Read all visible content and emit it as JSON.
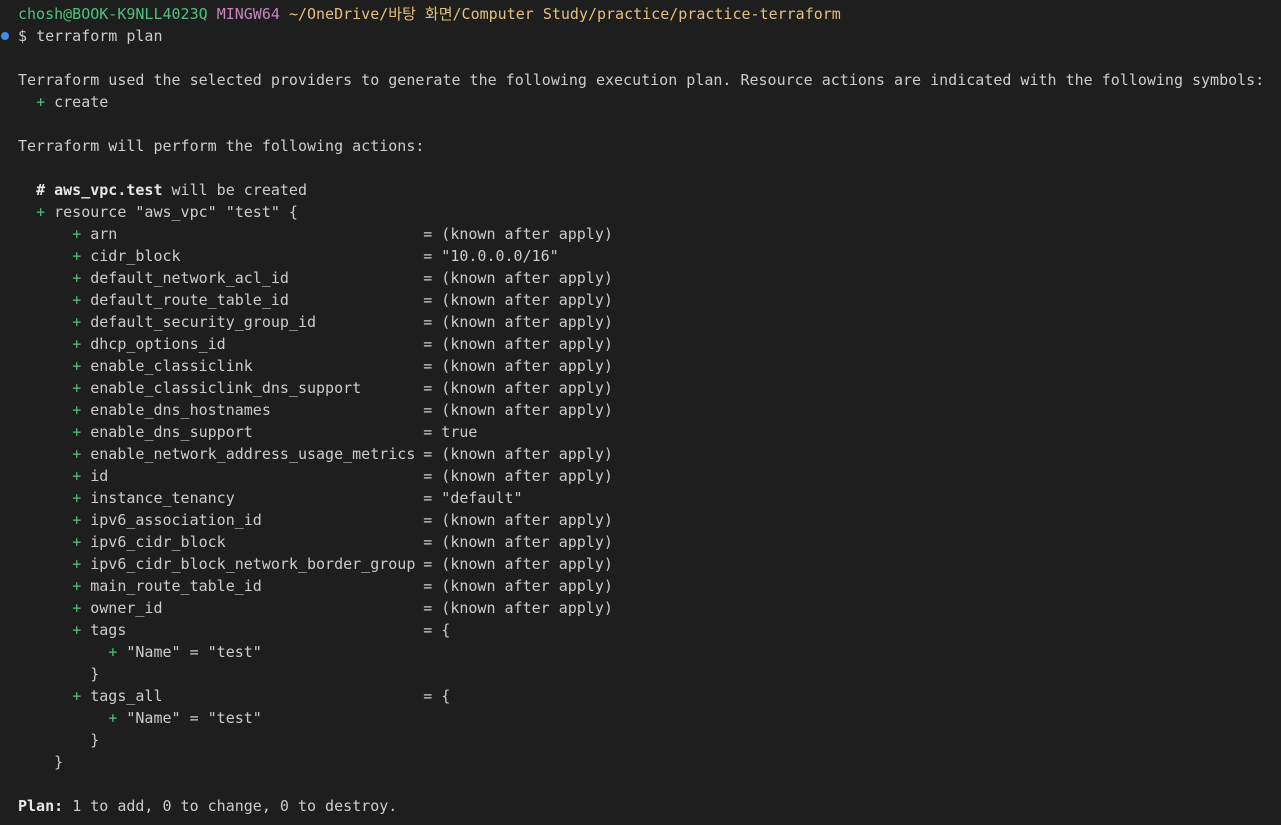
{
  "colors": {
    "background": "#1e1e1e",
    "text": "#cccccc",
    "user": "#4ec27a",
    "mingw": "#c586c0",
    "path": "#e5c07b",
    "plus": "#4ec27a",
    "prompt_dot": "#3b8eea"
  },
  "prompt": {
    "user_host": "chosh@BOOK-K9NLL4023Q",
    "shell": "MINGW64",
    "path": "~/OneDrive/바탕 화면/Computer Study/practice/practice-terraform",
    "symbol": "$",
    "command": "terraform plan"
  },
  "intro": {
    "line1": "Terraform used the selected providers to generate the following execution plan. Resource actions are indicated with the following symbols:",
    "symbol_plus": "+",
    "symbol_create": "create",
    "line2": "Terraform will perform the following actions:"
  },
  "resource": {
    "comment_hash": "#",
    "address": "aws_vpc.test",
    "comment_suffix": "will be created",
    "plus": "+",
    "header": "resource \"aws_vpc\" \"test\" {",
    "attributes": [
      {
        "name": "arn",
        "value": "= (known after apply)"
      },
      {
        "name": "cidr_block",
        "value": "= \"10.0.0.0/16\""
      },
      {
        "name": "default_network_acl_id",
        "value": "= (known after apply)"
      },
      {
        "name": "default_route_table_id",
        "value": "= (known after apply)"
      },
      {
        "name": "default_security_group_id",
        "value": "= (known after apply)"
      },
      {
        "name": "dhcp_options_id",
        "value": "= (known after apply)"
      },
      {
        "name": "enable_classiclink",
        "value": "= (known after apply)"
      },
      {
        "name": "enable_classiclink_dns_support",
        "value": "= (known after apply)"
      },
      {
        "name": "enable_dns_hostnames",
        "value": "= (known after apply)"
      },
      {
        "name": "enable_dns_support",
        "value": "= true"
      },
      {
        "name": "enable_network_address_usage_metrics",
        "value": "= (known after apply)"
      },
      {
        "name": "id",
        "value": "= (known after apply)"
      },
      {
        "name": "instance_tenancy",
        "value": "= \"default\""
      },
      {
        "name": "ipv6_association_id",
        "value": "= (known after apply)"
      },
      {
        "name": "ipv6_cidr_block",
        "value": "= (known after apply)"
      },
      {
        "name": "ipv6_cidr_block_network_border_group",
        "value": "= (known after apply)"
      },
      {
        "name": "main_route_table_id",
        "value": "= (known after apply)"
      },
      {
        "name": "owner_id",
        "value": "= (known after apply)"
      }
    ],
    "tags": {
      "name": "tags",
      "open": "= {",
      "entry": "\"Name\" = \"test\"",
      "close": "}"
    },
    "tags_all": {
      "name": "tags_all",
      "open": "= {",
      "entry": "\"Name\" = \"test\"",
      "close": "}"
    },
    "close": "}"
  },
  "summary": {
    "label": "Plan:",
    "text": "1 to add, 0 to change, 0 to destroy."
  }
}
